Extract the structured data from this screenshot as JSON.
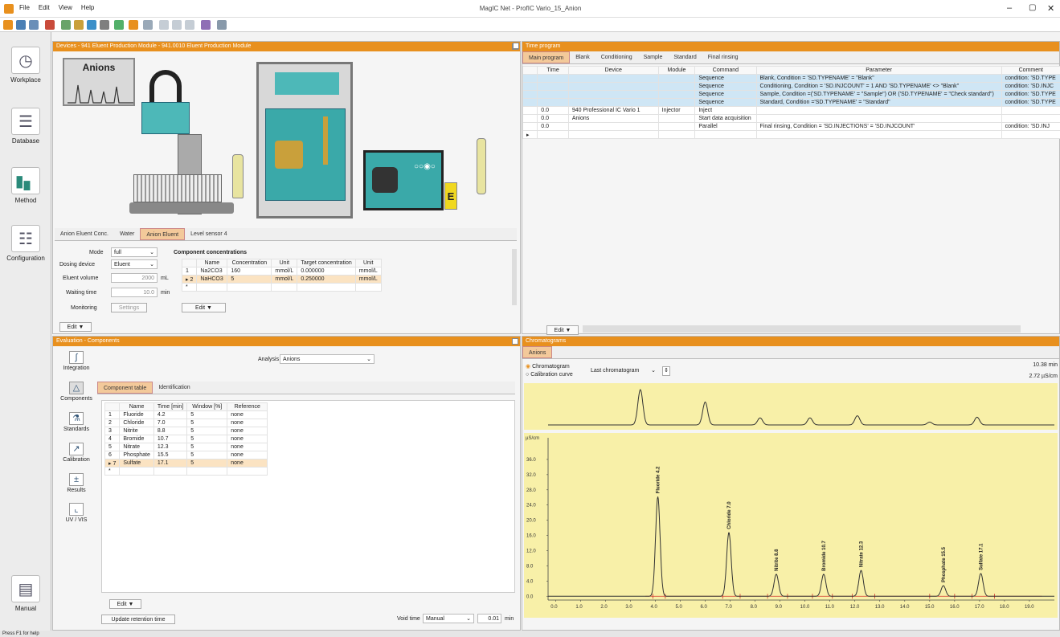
{
  "window": {
    "title": "MagIC Net - ProfIC Vario_15_Anion",
    "menu": [
      "File",
      "Edit",
      "View",
      "Help"
    ],
    "controls": [
      "–",
      "▢",
      "✕"
    ]
  },
  "nav": {
    "items": [
      {
        "label": "Workplace",
        "icon": "clock-play-icon"
      },
      {
        "label": "Database",
        "icon": "database-icon"
      },
      {
        "label": "Method",
        "icon": "chart-icon"
      },
      {
        "label": "Configuration",
        "icon": "sliders-icon"
      }
    ],
    "manual": "Manual"
  },
  "devices": {
    "title": "Devices - 941 Eluent Production Module - 941.0010 Eluent Production Module",
    "illustration_text": "Anions",
    "e_label": "E",
    "tabs": [
      "Anion Eluent Conc.",
      "Water",
      "Anion Eluent",
      "Level sensor 4"
    ],
    "form": {
      "mode_label": "Mode",
      "mode": "full",
      "dosing_label": "Dosing device",
      "dosing": "Eluent",
      "volume_label": "Eluent volume",
      "volume": "2000",
      "volume_unit": "mL",
      "wait_label": "Waiting time",
      "wait": "10.0",
      "wait_unit": "min",
      "monitoring_label": "Monitoring",
      "settings": "Settings",
      "edit": "Edit ▼"
    },
    "components": {
      "title": "Component concentrations",
      "headers": [
        "",
        "Name",
        "Concentration",
        "Unit",
        "Target concentration",
        "Unit"
      ],
      "rows": [
        [
          "1",
          "Na2CO3",
          "160",
          "mmol/L",
          "0.000000",
          "mmol/L"
        ],
        [
          "▸ 2",
          "NaHCO3",
          "5",
          "mmol/L",
          "0.250000",
          "mmol/L"
        ],
        [
          "*",
          "",
          "",
          "",
          "",
          ""
        ]
      ],
      "edit": "Edit ▼"
    }
  },
  "time_program": {
    "title": "Time program",
    "tabs": [
      "Main program",
      "Blank",
      "Conditioning",
      "Sample",
      "Standard",
      "Final rinsing"
    ],
    "headers": [
      "",
      "Time",
      "Device",
      "Module",
      "Command",
      "Parameter",
      "Comment"
    ],
    "rows": [
      [
        "",
        "",
        "",
        "",
        "Sequence",
        "Blank, Condition = 'SD.TYPENAME' = \"Blank\"",
        "condition: 'SD.TYPE"
      ],
      [
        "",
        "",
        "",
        "",
        "Sequence",
        "Conditioning, Condition = 'SD.INJCOUNT' = 1 AND 'SD.TYPENAME' <> \"Blank\"",
        "condition: 'SD.INJC"
      ],
      [
        "",
        "",
        "",
        "",
        "Sequence",
        "Sample, Condition =('SD.TYPENAME' = \"Sample\") OR ('SD.TYPENAME' = \"Check standard\")",
        "condition: 'SD.TYPE"
      ],
      [
        "",
        "",
        "",
        "",
        "Sequence",
        "Standard, Condition ='SD.TYPENAME' = \"Standard\"",
        "condition: 'SD.TYPE"
      ],
      [
        "",
        "0.0",
        "940 Professional IC Vario 1",
        "Injector",
        "Inject",
        "",
        ""
      ],
      [
        "",
        "0.0",
        "Anions",
        "",
        "Start data acquisition",
        "",
        ""
      ],
      [
        "",
        "0.0",
        "",
        "",
        "Parallel",
        "Final rinsing, Condition = 'SD.INJECTIONS' = 'SD.INJCOUNT'",
        "condition: 'SD.INJ"
      ],
      [
        "▸",
        "",
        "",
        "",
        "",
        "",
        ""
      ]
    ],
    "edit": "Edit ▼"
  },
  "evaluation": {
    "title": "Evaluation - Components",
    "side": [
      "Integration",
      "Components",
      "Standards",
      "Calibration",
      "Results",
      "UV / VIS"
    ],
    "analysis_label": "Analysis",
    "analysis": "Anions",
    "tabs": [
      "Component table",
      "Identification"
    ],
    "headers": [
      "",
      "Name",
      "Time [min]",
      "Window [%]",
      "Reference"
    ],
    "rows": [
      [
        "1",
        "Fluoride",
        "4.2",
        "5",
        "none"
      ],
      [
        "2",
        "Chloride",
        "7.0",
        "5",
        "none"
      ],
      [
        "3",
        "Nitrite",
        "8.8",
        "5",
        "none"
      ],
      [
        "4",
        "Bromide",
        "10.7",
        "5",
        "none"
      ],
      [
        "5",
        "Nitrate",
        "12.3",
        "5",
        "none"
      ],
      [
        "6",
        "Phosphate",
        "15.5",
        "5",
        "none"
      ],
      [
        "▸ 7",
        "Sulfate",
        "17.1",
        "5",
        "none"
      ],
      [
        "*",
        "",
        "",
        "",
        ""
      ]
    ],
    "edit": "Edit ▼",
    "update": "Update retention time",
    "void_label": "Void time",
    "void_mode": "Manual",
    "void_value": "0.01",
    "void_unit": "min"
  },
  "chromatograms": {
    "title": "Chromatograms",
    "tab": "Anions",
    "radio1": "Chromatogram",
    "radio2": "Calibration curve",
    "select": "Last chromatogram",
    "readout_time": "10.38 min",
    "readout_signal": "2.72 µS/cm",
    "yunit": "µS/cm"
  },
  "chart_data": {
    "type": "line",
    "x_ticks": [
      "0.0",
      "1.0",
      "2.0",
      "3.0",
      "4.0",
      "5.0",
      "6.0",
      "7.0",
      "8.0",
      "9.0",
      "10.0",
      "11.0",
      "12.0",
      "13.0",
      "14.0",
      "15.0",
      "16.0",
      "17.0",
      "18.0",
      "19.0"
    ],
    "y_ticks": [
      "0.0",
      "4.0",
      "8.0",
      "12.0",
      "16.0",
      "20.0",
      "24.0",
      "28.0",
      "32.0",
      "36.0"
    ],
    "xlim": [
      -0.3,
      20
    ],
    "ylim": [
      -1,
      40
    ],
    "peaks": [
      {
        "label": "Fluoride 4.2",
        "x": 4.1,
        "y": 26.2
      },
      {
        "label": "Chloride 7.0",
        "x": 6.95,
        "y": 16.8
      },
      {
        "label": "Nitrite 8.8",
        "x": 8.85,
        "y": 5.8
      },
      {
        "label": "Bromide 10.7",
        "x": 10.75,
        "y": 5.8
      },
      {
        "label": "Nitrate 12.3",
        "x": 12.25,
        "y": 6.8
      },
      {
        "label": "Phosphate 15.5",
        "x": 15.55,
        "y": 2.8
      },
      {
        "label": "Sulfate 17.1",
        "x": 17.05,
        "y": 6.0
      }
    ],
    "overview_peaks": [
      {
        "x": 3.4,
        "y": 10
      },
      {
        "x": 6.0,
        "y": 6.5
      },
      {
        "x": 8.2,
        "y": 2
      },
      {
        "x": 10.2,
        "y": 2
      },
      {
        "x": 12.1,
        "y": 2.6
      },
      {
        "x": 15.0,
        "y": 0.8
      },
      {
        "x": 16.9,
        "y": 2.2
      }
    ],
    "baseline_markers": [
      3.9,
      4.4,
      6.7,
      7.4,
      8.5,
      9.3,
      10.3,
      11.1,
      11.9,
      12.8,
      15.0,
      16.0,
      16.7,
      17.6
    ]
  },
  "status": "Press F1 for help",
  "colors": {
    "accent": "#e8901e",
    "chart_bg": "#f8f0a8",
    "trace": "#333333",
    "marker": "#d0302a"
  }
}
